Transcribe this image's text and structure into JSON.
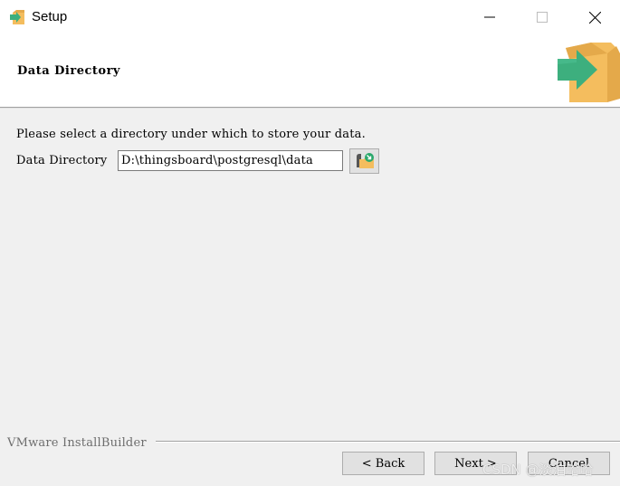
{
  "window": {
    "title": "Setup",
    "icon": "installer-box-icon",
    "controls": {
      "minimize": "minimize-icon",
      "maximize": "maximize-icon",
      "close": "close-icon"
    }
  },
  "header": {
    "page_title": "Data Directory",
    "logo": "installer-box-arrow-icon"
  },
  "content": {
    "instruction": "Please select a directory under which to store your data.",
    "field_label": "Data Directory",
    "field_value": "D:\\thingsboard\\postgresql\\data",
    "browse_icon": "folder-browse-icon"
  },
  "footer": {
    "brand": "VMware InstallBuilder",
    "buttons": {
      "back": "< Back",
      "next": "Next >",
      "cancel": "Cancel"
    }
  },
  "watermark": "CSDN @淡泊哈哈",
  "colors": {
    "box_orange": "#f4bd5e",
    "box_dark": "#e4a94a",
    "arrow_green": "#3daf7e",
    "body_bg": "#f0f0f0"
  }
}
